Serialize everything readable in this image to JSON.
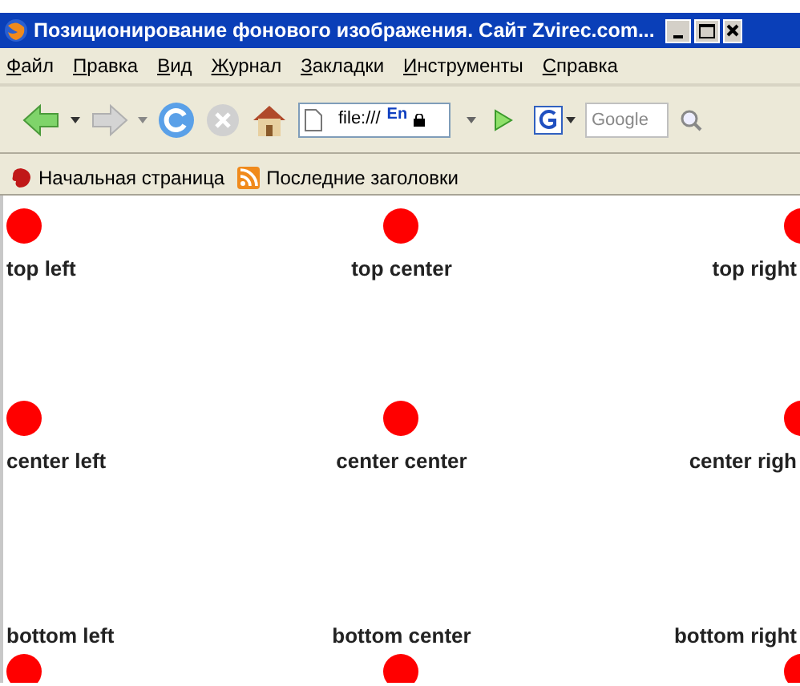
{
  "window": {
    "title": "Позиционирование фонового изображения. Сайт Zvirec.com..."
  },
  "menu": [
    "Файл",
    "Правка",
    "Вид",
    "Журнал",
    "Закладки",
    "Инструменты",
    "Справка"
  ],
  "toolbar": {
    "address": "file:///",
    "language": "En",
    "search_placeholder": "Google"
  },
  "bookmarks": [
    "Начальная страница",
    "Последние заголовки"
  ],
  "cells": [
    {
      "label": "top left",
      "kind": "top-left"
    },
    {
      "label": "top center",
      "kind": "top-center"
    },
    {
      "label": "top right",
      "kind": "top-right"
    },
    {
      "label": "center left",
      "kind": "center-left"
    },
    {
      "label": "center center",
      "kind": "center-center"
    },
    {
      "label": "center righ",
      "kind": "center-right"
    },
    {
      "label": "bottom left",
      "kind": "bottom-left"
    },
    {
      "label": "bottom center",
      "kind": "bottom-center"
    },
    {
      "label": "bottom right",
      "kind": "bottom-right"
    }
  ]
}
